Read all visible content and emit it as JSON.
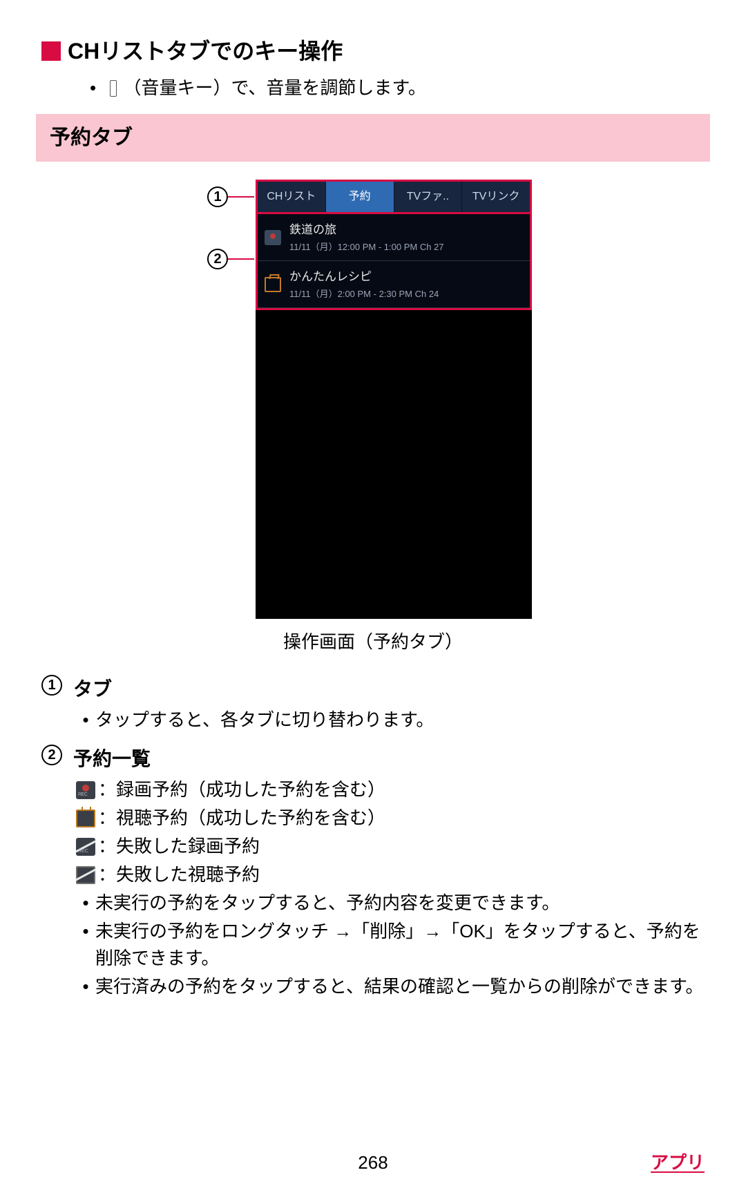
{
  "heading1": "CHリストタブでのキー操作",
  "bullet1_prefix": "（音量キー）で、音量を調節します。",
  "pink_heading": "予約タブ",
  "callouts": {
    "c1": "1",
    "c2": "2"
  },
  "tabs": {
    "t0": "CHリスト",
    "t1": "予約",
    "t2": "TVファ..",
    "t3": "TVリンク"
  },
  "reservations": [
    {
      "title": "鉄道の旅",
      "sub": "11/11（月）12:00 PM - 1:00 PM Ch 27",
      "icon": "rec"
    },
    {
      "title": "かんたんレシピ",
      "sub": "11/11（月）2:00 PM - 2:30 PM Ch 24",
      "icon": "tv"
    }
  ],
  "caption": "操作画面（予約タブ）",
  "desc1": {
    "num": "1",
    "title": "タブ",
    "b1": "タップすると、各タブに切り替わります。"
  },
  "desc2": {
    "num": "2",
    "title": "予約一覧",
    "legend": {
      "rec": "：録画予約（成功した予約を含む）",
      "tv": "：視聴予約（成功した予約を含む）",
      "rec_fail": "：失敗した録画予約",
      "tv_fail": "：失敗した視聴予約"
    },
    "b1": "未実行の予約をタップすると、予約内容を変更できます。",
    "b2": "未実行の予約をロングタッチ →「削除」→「OK」をタップすると、予約を削除できます。",
    "b3": "実行済みの予約をタップすると、結果の確認と一覧からの削除ができます。"
  },
  "page_number": "268",
  "section": "アプリ"
}
